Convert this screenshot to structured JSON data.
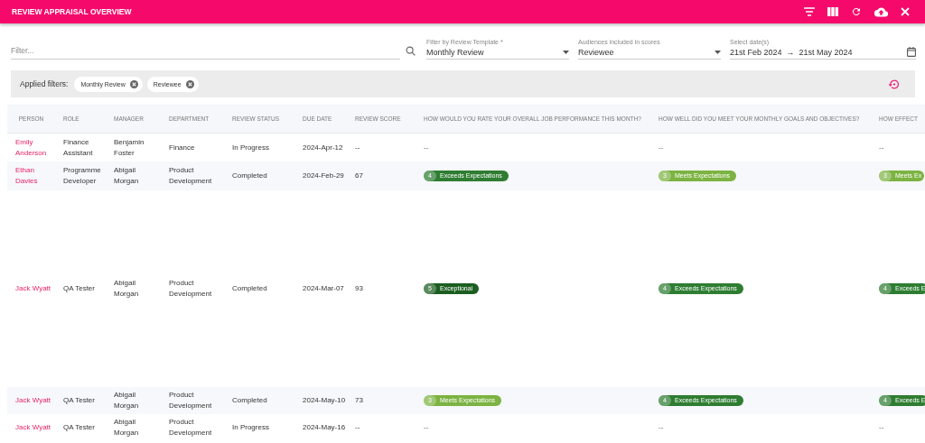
{
  "app_bar": {
    "title": "REVIEW APPRAISAL OVERVIEW"
  },
  "filters": {
    "search": {
      "placeholder": "Filter..."
    },
    "template": {
      "label": "Filter by Review Template *",
      "value": "Monthly Review"
    },
    "audiences": {
      "label": "Audiences included in scores",
      "value": "Reviewee"
    },
    "dates": {
      "label": "Select date(s)",
      "start": "21st Feb 2024",
      "separator": "→",
      "end": "21st May 2024"
    }
  },
  "applied_filters": {
    "label": "Applied filters:",
    "chips": [
      "Monthly Review",
      "Reviewee"
    ]
  },
  "table": {
    "columns": [
      "PERSON",
      "ROLE",
      "MANAGER",
      "DEPARTMENT",
      "REVIEW STATUS",
      "DUE DATE",
      "REVIEW SCORE",
      "HOW WOULD YOU RATE YOUR OVERALL JOB PERFORMANCE THIS MONTH?",
      "HOW WELL DID YOU MEET YOUR MONTHLY GOALS AND OBJECTIVES?",
      "HOW EFFECT"
    ],
    "rows": [
      {
        "person": "Emily Anderson",
        "role": "Finance Assistant",
        "manager": "Benjamin Foster",
        "department": "Finance",
        "status": "In Progress",
        "due_date": "2024-Apr-12",
        "score": "--",
        "answers": [
          {
            "kind": "empty",
            "text": "--"
          },
          {
            "kind": "empty",
            "text": "--"
          },
          {
            "kind": "empty",
            "text": "--"
          }
        ]
      },
      {
        "person": "Ethan Davies",
        "role": "Programme Developer",
        "manager": "Abigail Morgan",
        "department": "Product Development",
        "status": "Completed",
        "due_date": "2024-Feb-29",
        "score": "67",
        "answers": [
          {
            "kind": "rating",
            "score": "4",
            "label": "Exceeds Expectations",
            "color": "#2e7d32"
          },
          {
            "kind": "rating",
            "score": "3",
            "label": "Meets Expectations",
            "color": "#7cb342"
          },
          {
            "kind": "rating",
            "score": "3",
            "label": "Meets Ex",
            "color": "#7cb342"
          }
        ]
      },
      {
        "person": "Jack Wyatt",
        "role": "QA Tester",
        "manager": "Abigail Morgan",
        "department": "Product Development",
        "status": "Completed",
        "due_date": "2024-Mar-07",
        "score": "93",
        "answers": [
          {
            "kind": "rating",
            "score": "5",
            "label": "Exceptional",
            "color": "#1b5e20"
          },
          {
            "kind": "rating",
            "score": "4",
            "label": "Exceeds Expectations",
            "color": "#2e7d32"
          },
          {
            "kind": "rating",
            "score": "4",
            "label": "Exceeds E",
            "color": "#2e7d32"
          }
        ]
      },
      {
        "person": "Jack Wyatt",
        "role": "QA Tester",
        "manager": "Abigail Morgan",
        "department": "Product Development",
        "status": "Completed",
        "due_date": "2024-May-10",
        "score": "73",
        "answers": [
          {
            "kind": "rating",
            "score": "3",
            "label": "Meets Expectations",
            "color": "#7cb342"
          },
          {
            "kind": "rating",
            "score": "4",
            "label": "Exceeds Expectations",
            "color": "#2e7d32"
          },
          {
            "kind": "rating",
            "score": "4",
            "label": "Exceeds E",
            "color": "#2e7d32"
          }
        ]
      },
      {
        "person": "Jack Wyatt",
        "role": "QA Tester",
        "manager": "Abigail Morgan",
        "department": "Product Development",
        "status": "In Progress",
        "due_date": "2024-May-16",
        "score": "--",
        "answers": [
          {
            "kind": "empty",
            "text": "--"
          },
          {
            "kind": "empty",
            "text": "--"
          },
          {
            "kind": "empty",
            "text": "--"
          }
        ]
      }
    ]
  }
}
